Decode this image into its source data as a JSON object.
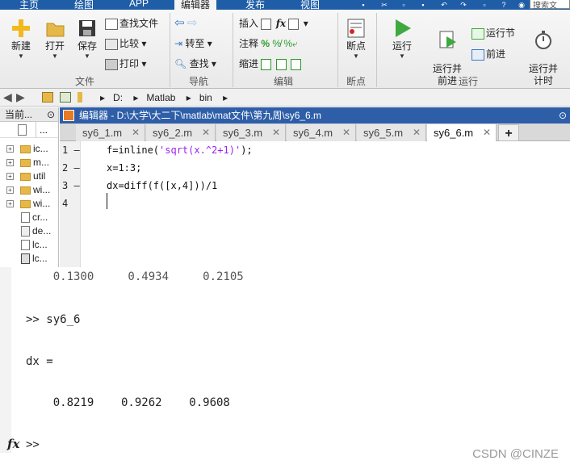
{
  "top_menu": {
    "tabs": [
      "主页",
      "绘图",
      "APP",
      "编辑器",
      "发布",
      "视图"
    ],
    "active_tab": "编辑器",
    "search_placeholder": "搜索文"
  },
  "ribbon": {
    "file_group": {
      "label": "文件",
      "new": "新建",
      "open": "打开",
      "save": "保存"
    },
    "edit_tools": {
      "find_files": "查找文件",
      "compare": "比较",
      "print": "打印"
    },
    "nav_group": {
      "label": "导航",
      "goto": "转至",
      "find": "查找"
    },
    "edit_group": {
      "label": "编辑",
      "insert": "插入",
      "comment": "注释",
      "indent": "缩进",
      "fx": "fx"
    },
    "breakpoint_group": {
      "label": "断点",
      "breakpoint": "断点"
    },
    "run_group": {
      "label": "运行",
      "run": "运行",
      "run_advance": "运行并\n前进",
      "run_section": "运行节",
      "advance": "前进",
      "run_time": "运行并\n计时"
    }
  },
  "address_bar": {
    "path": [
      "D:",
      "Matlab",
      "bin"
    ]
  },
  "current_folder": {
    "header": "当前...",
    "column": "...",
    "items": [
      {
        "name": "ic...",
        "type": "folder"
      },
      {
        "name": "m...",
        "type": "folder"
      },
      {
        "name": "util",
        "type": "folder"
      },
      {
        "name": "wi...",
        "type": "folder"
      },
      {
        "name": "wi...",
        "type": "folder"
      },
      {
        "name": "cr...",
        "type": "file"
      },
      {
        "name": "de...",
        "type": "file"
      },
      {
        "name": "lc...",
        "type": "file"
      },
      {
        "name": "lc...",
        "type": "file"
      }
    ]
  },
  "editor": {
    "title": "编辑器 - D:\\大学\\大二下\\matlab\\mat文件\\第九周\\sy6_6.m",
    "tabs": [
      "sy6_1.m",
      "sy6_2.m",
      "sy6_3.m",
      "sy6_4.m",
      "sy6_5.m",
      "sy6_6.m"
    ],
    "active_tab": "sy6_6.m",
    "lines": [
      {
        "num": "1",
        "marker": "—",
        "pre": "f=inline(",
        "str": "'sqrt(x.^2+1)'",
        "post": ");"
      },
      {
        "num": "2",
        "marker": "—",
        "pre": "x=1:3;",
        "str": "",
        "post": ""
      },
      {
        "num": "3",
        "marker": "—",
        "pre": "dx=diff(f([x,4]))/1",
        "str": "",
        "post": ""
      },
      {
        "num": "4",
        "marker": "",
        "pre": "",
        "str": "",
        "post": ""
      }
    ]
  },
  "command_window": {
    "partial_prev": "    0.1300     0.4934     0.2105",
    "prompt_cmd": ">> sy6_6",
    "var_line": "dx =",
    "values": "    0.8219    0.9262    0.9608",
    "prompt": ">>",
    "fx_label": "fx"
  },
  "watermark": "CSDN @CINZE"
}
